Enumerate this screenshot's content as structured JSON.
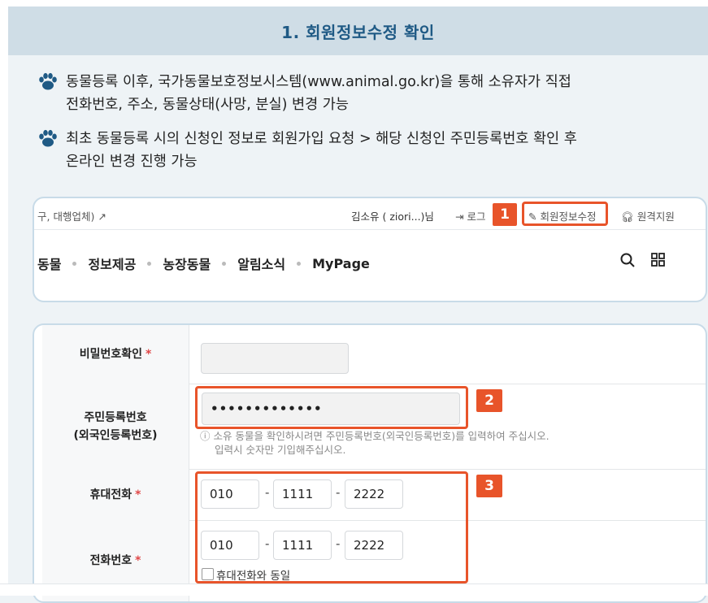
{
  "header": {
    "title": "1. 회원정보수정 확인"
  },
  "bullets": [
    {
      "line1": "동물등록 이후, 국가동물보호정보시스템(www.animal.go.kr)을 통해 소유자가 직접",
      "line2": "전화번호, 주소, 동물상태(사망, 분실) 변경 가능"
    },
    {
      "line1": "최초 동물등록 시의 신청인 정보로 회원가입 요청 > 해당 신청인 주민등록번호 확인 후",
      "line2": "온라인 변경 진행 가능"
    }
  ],
  "site_header": {
    "util_left": "구, 대행업체)",
    "user": "김소유 ( ziori...)님",
    "login": "로그",
    "edit_info": "회원정보수정",
    "remote": "원격지원",
    "nav": [
      "동물",
      "정보제공",
      "농장동물",
      "알림소식",
      "MyPage"
    ]
  },
  "form": {
    "password_confirm_label": "비밀번호확인",
    "resident_label_1": "주민등록번호",
    "resident_label_2": "(외국인등록번호)",
    "resident_value": "•••••••••••••",
    "resident_hint_1": "ⓘ 소유 동물을 확인하시려면 주민등록번호(외국인등록번호)를 입력하여 주십시오.",
    "resident_hint_2": "입력시 숫자만 기입해주십시오.",
    "mobile_label": "휴대전화",
    "mobile": [
      "010",
      "1111",
      "2222"
    ],
    "phone_label": "전화번호",
    "phone": [
      "010",
      "1111",
      "2222"
    ],
    "same_as_mobile": "휴대전화와 동일",
    "required_mark": "*",
    "dash": "-"
  },
  "annotations": [
    "1",
    "2",
    "3"
  ],
  "colors": {
    "accent": "#e8542a",
    "title": "#1f5a85",
    "band": "#cfdde6"
  }
}
